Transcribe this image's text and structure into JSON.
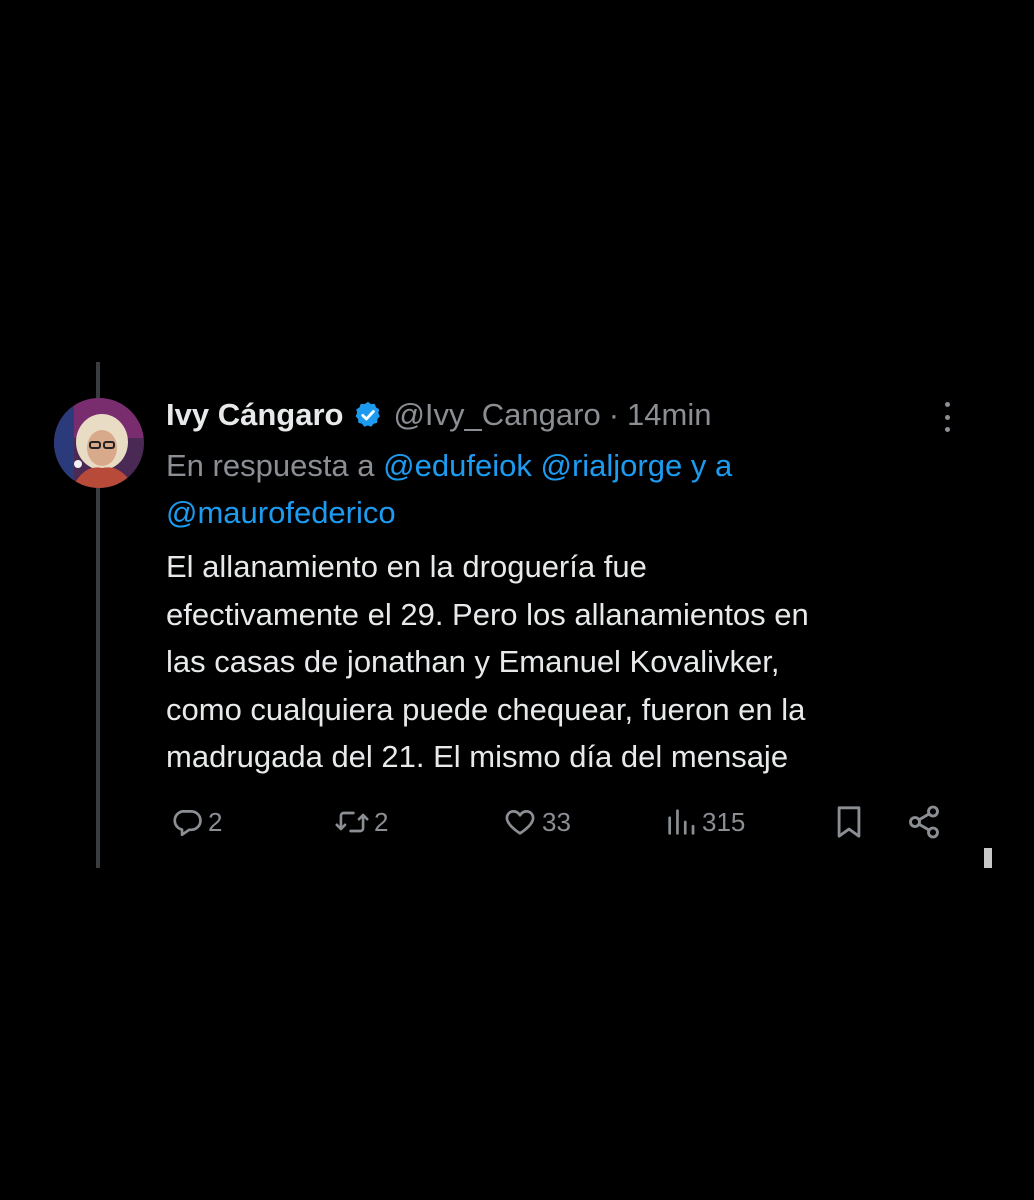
{
  "tweet": {
    "display_name": "Ivy Cángaro",
    "verified_icon": "verified-badge-icon",
    "handle": "@Ivy_Cangaro",
    "separator": "·",
    "time": "14min",
    "reply_prefix": "En respuesta a",
    "mentions": [
      "@edufeiok",
      "@rialjorge",
      "@maurofederico"
    ],
    "reply_joiner": "y a",
    "text": "El allanamiento en la droguería fue\nefectivamente el 29. Pero los allanamientos en\nlas casas de jonathan y Emanuel Kovalivker,\ncomo cualquiera puede chequear, fueron en la\nmadrugada del 21. El mismo día del mensaje",
    "stats": {
      "replies": "2",
      "reposts": "2",
      "likes": "33",
      "views": "315"
    }
  },
  "colors": {
    "background": "#000000",
    "text": "#e7e9ea",
    "muted": "#8b8f94",
    "accent": "#1d9bf0"
  },
  "icons": {
    "more": "more-vertical-icon",
    "reply": "reply-icon",
    "repost": "repost-icon",
    "like": "heart-icon",
    "views": "views-chart-icon",
    "bookmark": "bookmark-icon",
    "share": "share-icon"
  }
}
